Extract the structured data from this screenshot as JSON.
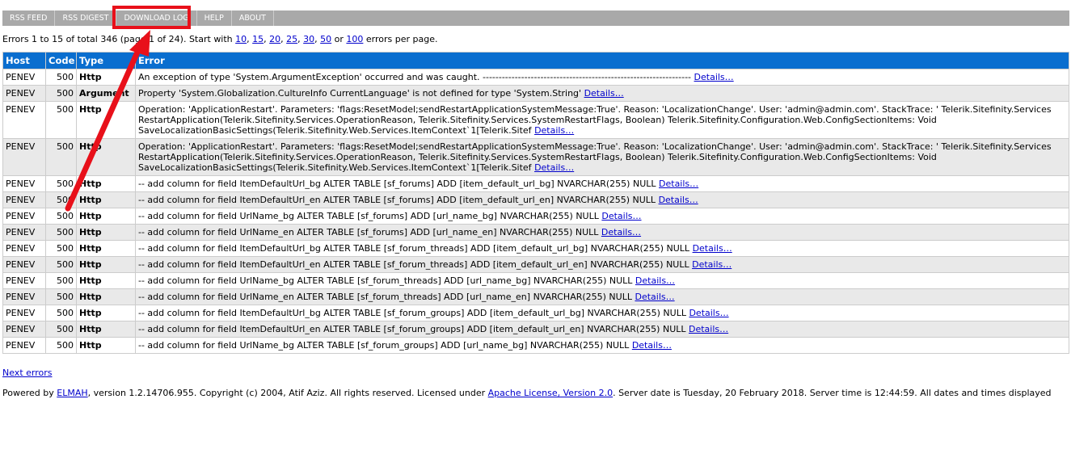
{
  "menu": [
    "RSS FEED",
    "RSS DIGEST",
    "DOWNLOAD LOG",
    "HELP",
    "ABOUT"
  ],
  "summary": {
    "prefix": "Errors 1 to 15 of total 346 (page 1 of 24). Start with ",
    "sizes": [
      "10",
      "15",
      "20",
      "25",
      "30",
      "50",
      "100"
    ],
    "or": " or ",
    "suffix": " errors per page."
  },
  "columns": [
    "Host",
    "Code",
    "Type",
    "Error"
  ],
  "details_label": "Details…",
  "rows": [
    {
      "host": "PENEV",
      "code": "500",
      "type": "Http",
      "error": "An exception of type 'System.ArgumentException' occurred and was caught. -----------------------------------------------------------------"
    },
    {
      "host": "PENEV",
      "code": "500",
      "type": "Argument",
      "error": "Property 'System.Globalization.CultureInfo CurrentLanguage' is not defined for type 'System.String'"
    },
    {
      "host": "PENEV",
      "code": "500",
      "type": "Http",
      "error": "Operation: 'ApplicationRestart'. Parameters: 'flags:ResetModel;sendRestartApplicationSystemMessage:True'. Reason: 'LocalizationChange'. User: 'admin@admin.com'. StackTrace: ' Telerik.Sitefinity.Services RestartApplication(Telerik.Sitefinity.Services.OperationReason, Telerik.Sitefinity.Services.SystemRestartFlags, Boolean) Telerik.Sitefinity.Configuration.Web.ConfigSectionItems: Void SaveLocalizationBasicSettings(Telerik.Sitefinity.Web.Services.ItemContext`1[Telerik.Sitef"
    },
    {
      "host": "PENEV",
      "code": "500",
      "type": "Http",
      "error": "Operation: 'ApplicationRestart'. Parameters: 'flags:ResetModel;sendRestartApplicationSystemMessage:True'. Reason: 'LocalizationChange'. User: 'admin@admin.com'. StackTrace: ' Telerik.Sitefinity.Services RestartApplication(Telerik.Sitefinity.Services.OperationReason, Telerik.Sitefinity.Services.SystemRestartFlags, Boolean) Telerik.Sitefinity.Configuration.Web.ConfigSectionItems: Void SaveLocalizationBasicSettings(Telerik.Sitefinity.Web.Services.ItemContext`1[Telerik.Sitef"
    },
    {
      "host": "PENEV",
      "code": "500",
      "type": "Http",
      "error": "-- add column for field ItemDefaultUrl_bg ALTER TABLE [sf_forums] ADD [item_default_url_bg] NVARCHAR(255) NULL"
    },
    {
      "host": "PENEV",
      "code": "500",
      "type": "Http",
      "error": "-- add column for field ItemDefaultUrl_en ALTER TABLE [sf_forums] ADD [item_default_url_en] NVARCHAR(255) NULL"
    },
    {
      "host": "PENEV",
      "code": "500",
      "type": "Http",
      "error": "-- add column for field UrlName_bg ALTER TABLE [sf_forums] ADD [url_name_bg] NVARCHAR(255) NULL"
    },
    {
      "host": "PENEV",
      "code": "500",
      "type": "Http",
      "error": "-- add column for field UrlName_en ALTER TABLE [sf_forums] ADD [url_name_en] NVARCHAR(255) NULL"
    },
    {
      "host": "PENEV",
      "code": "500",
      "type": "Http",
      "error": "-- add column for field ItemDefaultUrl_bg ALTER TABLE [sf_forum_threads] ADD [item_default_url_bg] NVARCHAR(255) NULL"
    },
    {
      "host": "PENEV",
      "code": "500",
      "type": "Http",
      "error": "-- add column for field ItemDefaultUrl_en ALTER TABLE [sf_forum_threads] ADD [item_default_url_en] NVARCHAR(255) NULL"
    },
    {
      "host": "PENEV",
      "code": "500",
      "type": "Http",
      "error": "-- add column for field UrlName_bg ALTER TABLE [sf_forum_threads] ADD [url_name_bg] NVARCHAR(255) NULL"
    },
    {
      "host": "PENEV",
      "code": "500",
      "type": "Http",
      "error": "-- add column for field UrlName_en ALTER TABLE [sf_forum_threads] ADD [url_name_en] NVARCHAR(255) NULL"
    },
    {
      "host": "PENEV",
      "code": "500",
      "type": "Http",
      "error": "-- add column for field ItemDefaultUrl_bg ALTER TABLE [sf_forum_groups] ADD [item_default_url_bg] NVARCHAR(255) NULL"
    },
    {
      "host": "PENEV",
      "code": "500",
      "type": "Http",
      "error": "-- add column for field ItemDefaultUrl_en ALTER TABLE [sf_forum_groups] ADD [item_default_url_en] NVARCHAR(255) NULL"
    },
    {
      "host": "PENEV",
      "code": "500",
      "type": "Http",
      "error": "-- add column for field UrlName_bg ALTER TABLE [sf_forum_groups] ADD [url_name_bg] NVARCHAR(255) NULL"
    }
  ],
  "next_label": "Next errors",
  "footer": {
    "p1": "Powered by ",
    "elmah": "ELMAH",
    "p2": ", version 1.2.14706.955. Copyright (c) 2004, Atif Aziz. All rights reserved. Licensed under ",
    "license": "Apache License, Version 2.0",
    "p3": ". Server date is Tuesday, 20 February 2018. Server time is 12:44:59. All dates and times displayed"
  },
  "colors": {
    "header": "#0a6ecf",
    "menu": "#a9a9a9",
    "annotation": "#e8101a"
  }
}
